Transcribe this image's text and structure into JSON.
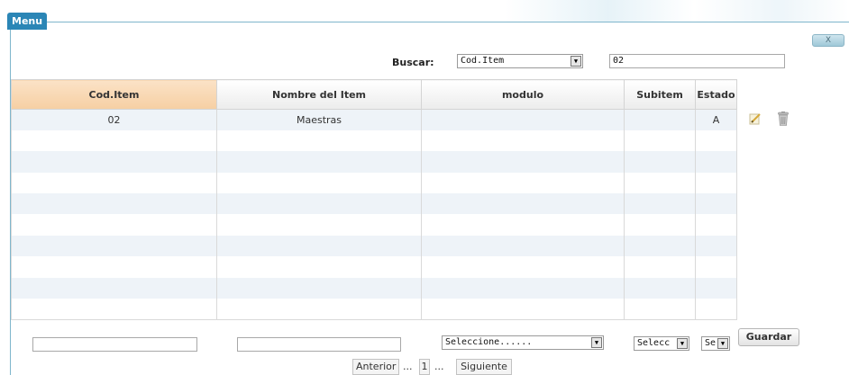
{
  "window": {
    "menu_tab": "Menu",
    "close_label": "X"
  },
  "search": {
    "label": "Buscar:",
    "field_selected": "Cod.Item",
    "value": "02"
  },
  "table": {
    "headers": [
      "Cod.Item",
      "Nombre del Item",
      "modulo",
      "Subitem",
      "Estado"
    ],
    "rows": [
      {
        "cod_item": "02",
        "nombre": "Maestras",
        "modulo": "",
        "subitem": "",
        "estado": "A"
      }
    ]
  },
  "form": {
    "cod_item_value": "",
    "nombre_value": "",
    "modulo_selected": "Seleccione......",
    "subitem_selected": "Selecc",
    "estado_selected": "Se",
    "save_label": "Guardar"
  },
  "pagination": {
    "prev_label": "Anterior",
    "ellipsis": "...",
    "current_page": "1",
    "next_label": "Siguiente"
  },
  "colors": {
    "accent": "#2b86b6",
    "sorted_header": "#f6cfa3",
    "row_alt": "#eef3f8"
  }
}
